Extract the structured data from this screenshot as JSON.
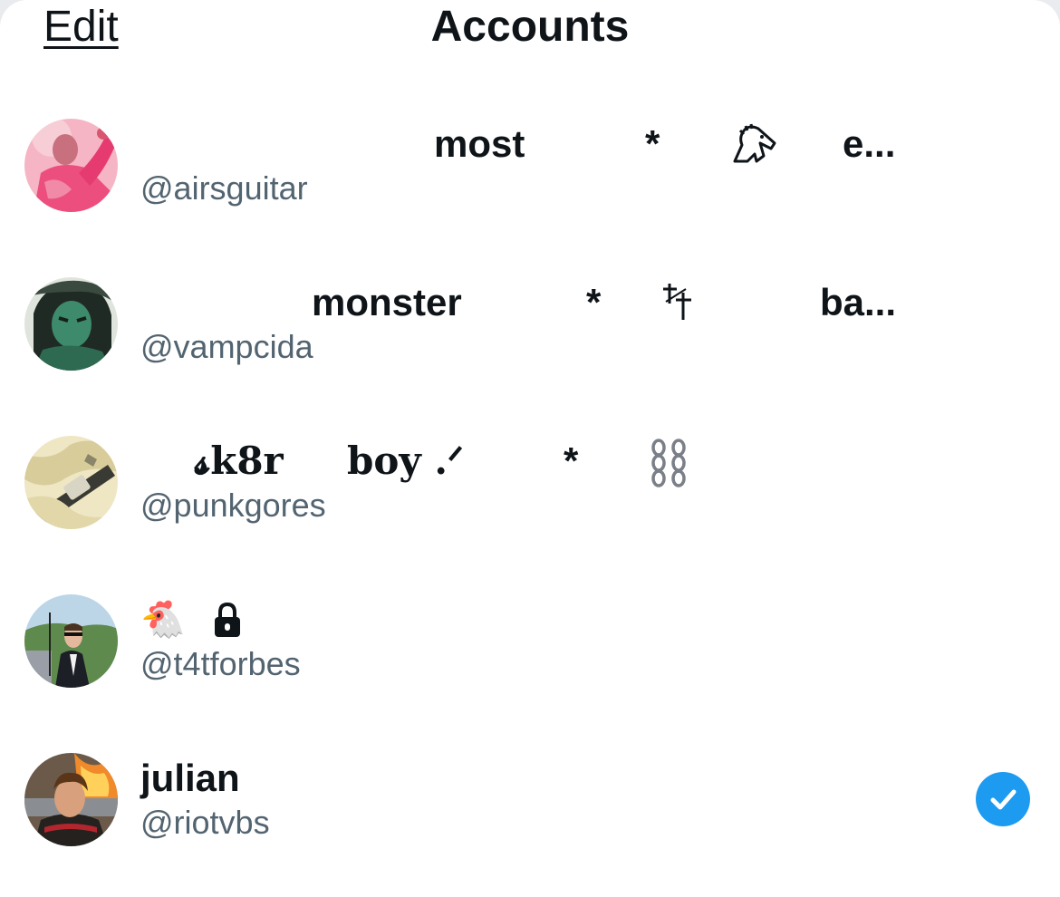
{
  "header": {
    "edit_label": "Edit",
    "title": "Accounts"
  },
  "accounts": [
    {
      "avatar": "avatar-photo-pink",
      "name_parts": [
        "most",
        "*",
        "𓃗",
        "e..."
      ],
      "handle": "@airsguitar",
      "selected": false
    },
    {
      "avatar": "avatar-photo-green",
      "name_parts": [
        "monster",
        "*",
        "⸸⸸",
        "ba..."
      ],
      "handle": "@vampcida",
      "selected": false
    },
    {
      "avatar": "avatar-photo-guitar",
      "name_parts": [
        "𝓼k8r",
        "boy .ᐟ",
        "*",
        "⛓"
      ],
      "handle": "@punkgores",
      "selected": false
    },
    {
      "avatar": "avatar-photo-suit",
      "name_parts": [
        "🐔",
        "🔒"
      ],
      "handle": "@t4tforbes",
      "selected": false
    },
    {
      "avatar": "avatar-photo-fire",
      "name_parts": [
        "julian"
      ],
      "handle": "@riotvbs",
      "selected": true
    }
  ],
  "colors": {
    "text_primary": "#0f1419",
    "text_secondary": "#536471",
    "accent": "#1d9bf0"
  },
  "icons": {
    "selected": "checkmark-icon",
    "locked": "lock-icon"
  }
}
